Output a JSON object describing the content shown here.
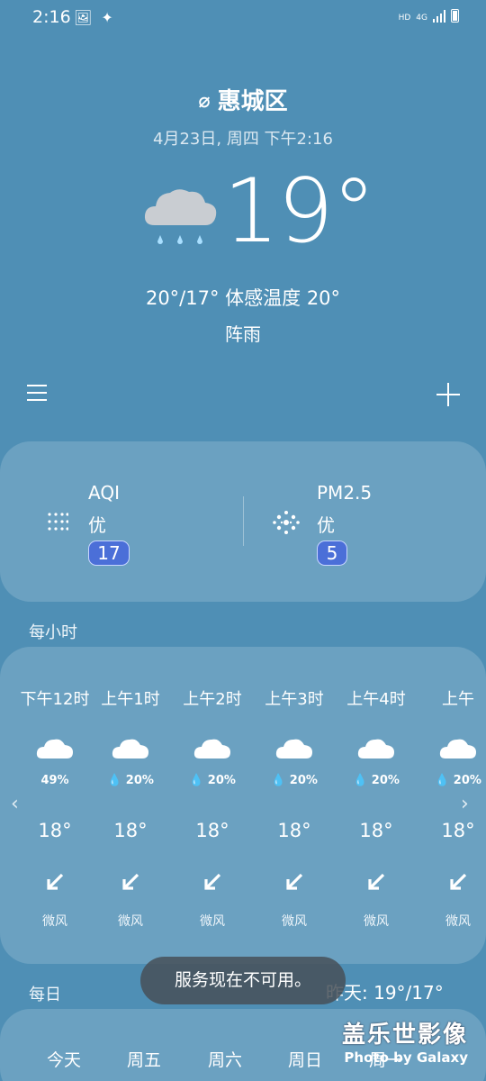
{
  "status": {
    "time": "2:16",
    "network_hd": "HD",
    "network_type": "4G"
  },
  "location": {
    "name": "惠城区",
    "datetime": "4月23日, 周四 下午2:16"
  },
  "current": {
    "temp": "19°",
    "range_feels": "20°/17° 体感温度 20°",
    "condition": "阵雨",
    "icon": "rain-cloud-icon"
  },
  "air": {
    "aqi": {
      "label": "AQI",
      "level": "优",
      "value": "17"
    },
    "pm25": {
      "label": "PM2.5",
      "level": "优",
      "value": "5"
    }
  },
  "hourly": {
    "title": "每小时",
    "items": [
      {
        "time": "下午12时",
        "precip": "49%",
        "temp": "18°",
        "wind": "微风"
      },
      {
        "time": "上午1时",
        "precip": "20%",
        "temp": "18°",
        "wind": "微风"
      },
      {
        "time": "上午2时",
        "precip": "20%",
        "temp": "18°",
        "wind": "微风"
      },
      {
        "time": "上午3时",
        "precip": "20%",
        "temp": "18°",
        "wind": "微风"
      },
      {
        "time": "上午4时",
        "precip": "20%",
        "temp": "18°",
        "wind": "微风"
      },
      {
        "time": "上午",
        "precip": "20%",
        "temp": "18°",
        "wind": "微风"
      }
    ]
  },
  "daily": {
    "title": "每日",
    "yesterday": "昨天: 19°/17°",
    "days": [
      "今天",
      "周五",
      "周六",
      "周日",
      "周一"
    ]
  },
  "toast": "服务现在不可用。",
  "watermark": {
    "title": "盖乐世影像",
    "subtitle": "Photo by Galaxy"
  }
}
